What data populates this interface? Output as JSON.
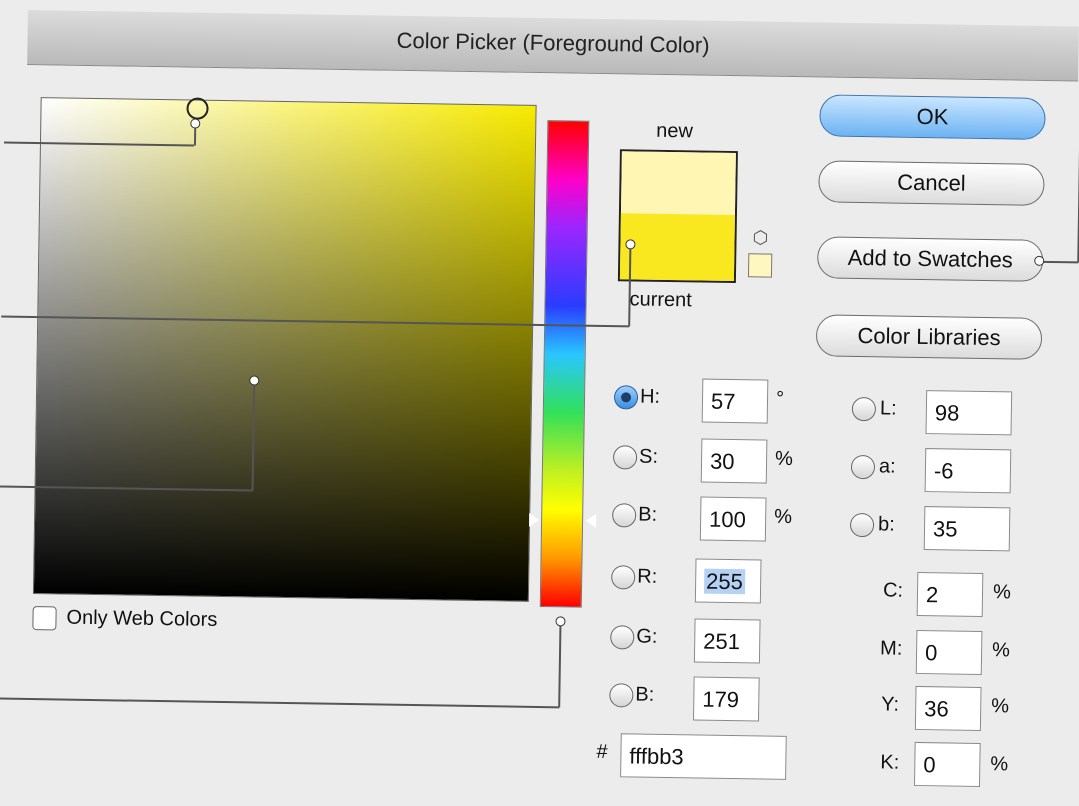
{
  "window": {
    "title": "Color Picker (Foreground Color)"
  },
  "buttons": {
    "ok": "OK",
    "cancel": "Cancel",
    "add_swatches": "Add to Swatches",
    "color_libraries": "Color Libraries"
  },
  "swatch": {
    "new_label": "new",
    "current_label": "current",
    "new_color": "#fff6b3",
    "current_color": "#f9e820"
  },
  "web_colors": {
    "label": "Only Web Colors",
    "checked": false
  },
  "hsb": [
    {
      "label": "H:",
      "value": "57",
      "unit": "°",
      "selected": true
    },
    {
      "label": "S:",
      "value": "30",
      "unit": "%",
      "selected": false
    },
    {
      "label": "B:",
      "value": "100",
      "unit": "%",
      "selected": false
    }
  ],
  "rgb": [
    {
      "label": "R:",
      "value": "255",
      "selected": false
    },
    {
      "label": "G:",
      "value": "251",
      "selected": false
    },
    {
      "label": "B:",
      "value": "179",
      "selected": false
    }
  ],
  "lab": [
    {
      "label": "L:",
      "value": "98"
    },
    {
      "label": "a:",
      "value": "-6"
    },
    {
      "label": "b:",
      "value": "35"
    }
  ],
  "cmyk": [
    {
      "label": "C:",
      "value": "2",
      "unit": "%"
    },
    {
      "label": "M:",
      "value": "0",
      "unit": "%"
    },
    {
      "label": "Y:",
      "value": "36",
      "unit": "%"
    },
    {
      "label": "K:",
      "value": "0",
      "unit": "%"
    }
  ],
  "hex": {
    "label": "#",
    "value": "fffbb3"
  },
  "colors": {
    "accent": "#6cb3f2",
    "field_hue": "#f7ea00"
  }
}
